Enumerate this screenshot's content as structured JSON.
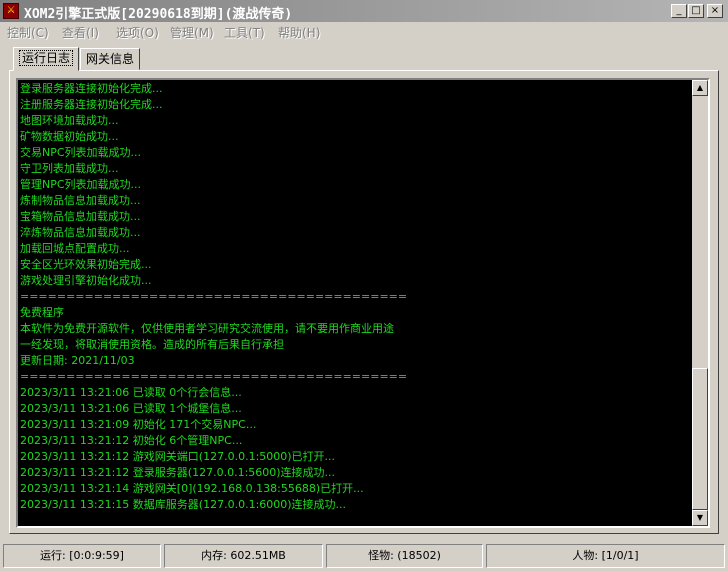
{
  "window": {
    "title": "XOM2引擎正式版[20290618到期](渡战传奇)",
    "icon": "app-logo-icon",
    "minimize_glyph": "_",
    "maximize_glyph": "□",
    "close_glyph": "×"
  },
  "menu": [
    {
      "label": "控制(C)"
    },
    {
      "label": "查看(I)"
    },
    {
      "label": "选项(O)"
    },
    {
      "label": "管理(M)"
    },
    {
      "label": "工具(T)"
    },
    {
      "label": "帮助(H)"
    }
  ],
  "tabs": [
    {
      "label": "运行日志",
      "active": true
    },
    {
      "label": "网关信息",
      "active": false
    }
  ],
  "log": [
    "登录服务器连接初始化完成...",
    "注册服务器连接初始化完成...",
    "地图环境加载成功...",
    "矿物数据初始成功...",
    "交易NPC列表加载成功...",
    "守卫列表加载成功...",
    "管理NPC列表加载成功...",
    "炼制物品信息加载成功...",
    "宝箱物品信息加载成功...",
    "淬炼物品信息加载成功...",
    "加载回城点配置成功...",
    "安全区光环效果初始完成...",
    "游戏处理引擎初始化成功...",
    "==========================================",
    "免费程序",
    "本软件为免费开源软件，仅供使用者学习研究交流使用，请不要用作商业用途",
    "一经发现，将取消使用资格。造成的所有后果自行承担",
    "更新日期: 2021/11/03",
    "==========================================",
    "2023/3/11 13:21:06 已读取 0个行会信息...",
    "2023/3/11 13:21:06 已读取 1个城堡信息...",
    "2023/3/11 13:21:09 初始化 171个交易NPC...",
    "2023/3/11 13:21:12 初始化 6个管理NPC...",
    "2023/3/11 13:21:12 游戏网关端口(127.0.0.1:5000)已打开...",
    "2023/3/11 13:21:12 登录服务器(127.0.0.1:5600)连接成功...",
    "2023/3/11 13:21:14 游戏网关[0](192.168.0.138:55688)已打开...",
    "2023/3/11 13:21:15 数据库服务器(127.0.0.1:6000)连接成功..."
  ],
  "scrollbar": {
    "up_glyph": "▲",
    "down_glyph": "▼"
  },
  "status": [
    {
      "text": "运行: [0:0:9:59]"
    },
    {
      "text": "内存: 602.51MB"
    },
    {
      "text": "怪物: (18502)"
    },
    {
      "text": "人物: [1/0/1]"
    }
  ],
  "colors": {
    "log_text": "#20d820",
    "log_background": "#000000",
    "titlebar": "#808080"
  }
}
